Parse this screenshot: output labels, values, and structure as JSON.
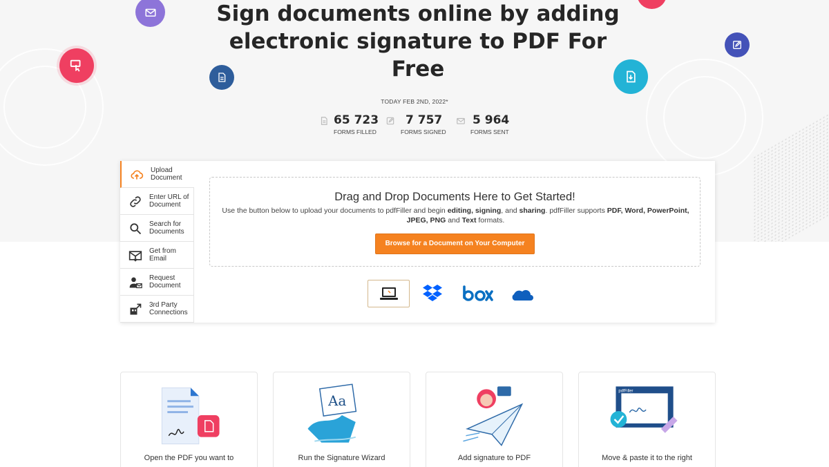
{
  "hero": {
    "title": "Sign documents online by adding electronic signature to PDF For Free",
    "today": "TODAY FEB 2ND, 2022*"
  },
  "stats": [
    {
      "value": "65 723",
      "label": "FORMS FILLED",
      "icon": "document-icon"
    },
    {
      "value": "7 757",
      "label": "FORMS SIGNED",
      "icon": "edit-icon"
    },
    {
      "value": "5 964",
      "label": "FORMS SENT",
      "icon": "envelope-icon"
    }
  ],
  "uploader": {
    "tabs": [
      {
        "label": "Upload Document",
        "icon": "cloud-upload-icon"
      },
      {
        "label": "Enter URL of Document",
        "icon": "link-icon"
      },
      {
        "label": "Search for Documents",
        "icon": "search-icon"
      },
      {
        "label": "Get from Email",
        "icon": "email-download-icon"
      },
      {
        "label": "Request Document",
        "icon": "user-request-icon"
      },
      {
        "label": "3rd Party Connections",
        "icon": "connections-icon"
      }
    ],
    "dropzone": {
      "title": "Drag and Drop Documents Here to Get Started!",
      "desc_1": "Use the button below to upload your documents to pdfFiller and begin",
      "desc_editing": "editing, signing",
      "desc_and": ", and",
      "desc_sharing": "sharing",
      "desc_2": ". pdfFiller supports",
      "desc_formats": "PDF, Word, PowerPoint, JPEG, PNG",
      "desc_and2": "and",
      "desc_text": "Text",
      "desc_3": "formats.",
      "browse_label": "Browse for a Document on Your Computer"
    },
    "providers": [
      {
        "name": "My Computer",
        "icon": "laptop-icon"
      },
      {
        "name": "Dropbox",
        "icon": "dropbox-icon"
      },
      {
        "name": "box",
        "icon": "box-logo-icon"
      },
      {
        "name": "OneDrive",
        "icon": "onedrive-icon"
      }
    ]
  },
  "cards": [
    {
      "text": "Open the PDF you want to"
    },
    {
      "text": "Run the Signature Wizard"
    },
    {
      "text": "Add signature to PDF"
    },
    {
      "text": "Move & paste it to the right"
    }
  ],
  "colors": {
    "accent": "#f58220",
    "pink": "#ef3f61",
    "purple": "#8d74d9",
    "navy": "#2e5d9b",
    "cyan": "#23b3d6",
    "indigo": "#4452b8"
  }
}
